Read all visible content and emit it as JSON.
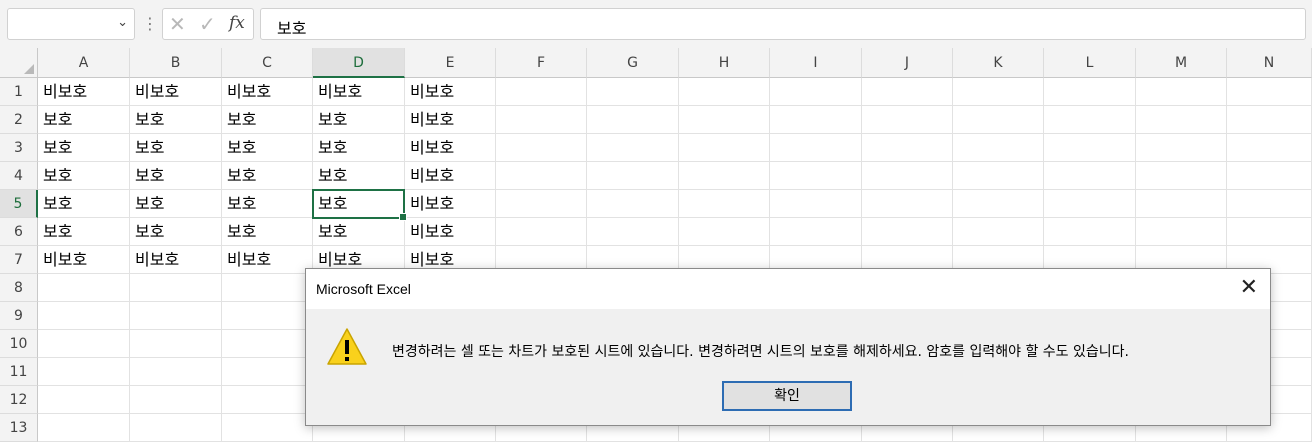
{
  "formula_bar": {
    "name_box_value": "",
    "name_box_dropdown_icon": "chevron-down-icon",
    "separator_icon": "vertical-ellipsis-icon",
    "cancel_icon": "cancel-x-icon",
    "enter_icon": "checkmark-icon",
    "function_label": "fx",
    "formula_value": "보호"
  },
  "sheet": {
    "columns": [
      "A",
      "B",
      "C",
      "D",
      "E",
      "F",
      "G",
      "H",
      "I",
      "J",
      "K",
      "L",
      "M",
      "N"
    ],
    "rows": [
      "1",
      "2",
      "3",
      "4",
      "5",
      "6",
      "7",
      "8",
      "9",
      "10",
      "11",
      "12",
      "13"
    ],
    "active_column": "D",
    "active_row": "5",
    "cells": [
      [
        "비보호",
        "비보호",
        "비보호",
        "비보호",
        "비보호"
      ],
      [
        "보호",
        "보호",
        "보호",
        "보호",
        "비보호"
      ],
      [
        "보호",
        "보호",
        "보호",
        "보호",
        "비보호"
      ],
      [
        "보호",
        "보호",
        "보호",
        "보호",
        "비보호"
      ],
      [
        "보호",
        "보호",
        "보호",
        "보호",
        "비보호"
      ],
      [
        "보호",
        "보호",
        "보호",
        "보호",
        "비보호"
      ],
      [
        "비보호",
        "비보호",
        "비보호",
        "비보호",
        "비보호"
      ]
    ]
  },
  "dialog": {
    "title": "Microsoft Excel",
    "close_label": "✕",
    "icon": "warning-icon",
    "message": "변경하려는 셀 또는 차트가 보호된 시트에 있습니다. 변경하려면 시트의 보호를 해제하세요. 암호를 입력해야 할 수도 있습니다.",
    "ok_label": "확인"
  },
  "colors": {
    "accent_green": "#1e7145",
    "dialog_button_border": "#2d6cb3",
    "warning_yellow": "#f9d11c"
  }
}
